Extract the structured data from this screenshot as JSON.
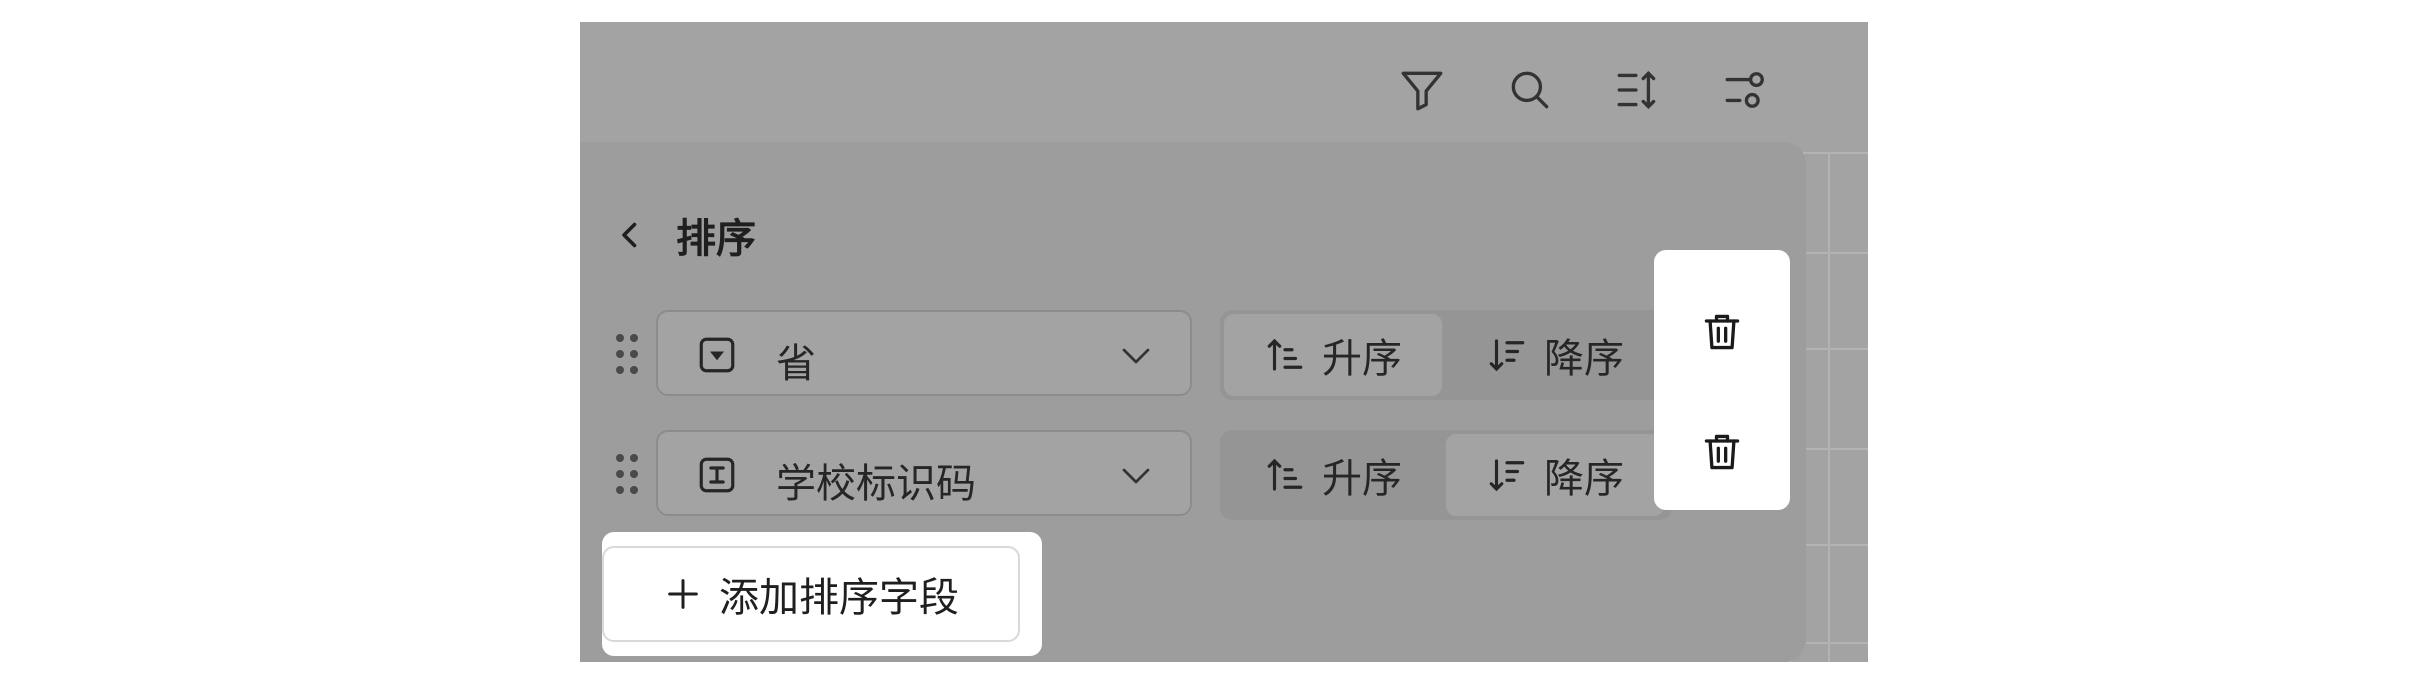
{
  "toolbar": {
    "icons": [
      "filter-icon",
      "search-icon",
      "sort-icon",
      "settings-icon"
    ]
  },
  "panel": {
    "title": "排序",
    "back_icon": "chevron-left-icon"
  },
  "sort_rules": [
    {
      "field_type_icon": "single-select-field-icon",
      "field": "省",
      "ascending_label": "升序",
      "descending_label": "降序",
      "selected": "ascending"
    },
    {
      "field_type_icon": "text-field-icon",
      "field": "学校标识码",
      "ascending_label": "升序",
      "descending_label": "降序",
      "selected": "descending"
    }
  ],
  "add_button": {
    "label": "添加排序字段"
  },
  "colors": {
    "overlay": "#a3a3a3",
    "highlight": "#ffffff",
    "text": "#262626"
  }
}
